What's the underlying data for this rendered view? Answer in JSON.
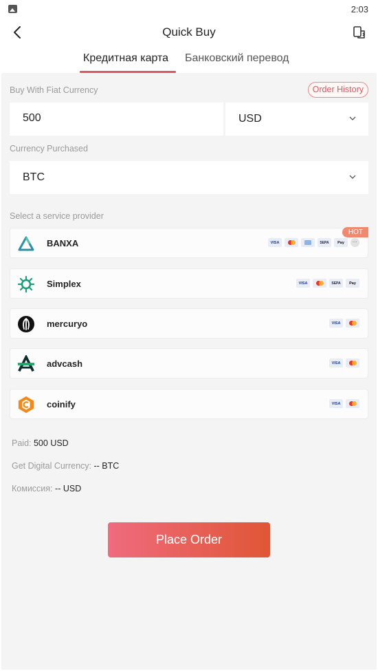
{
  "status_bar": {
    "time": "2:03"
  },
  "header": {
    "title": "Quick Buy"
  },
  "tabs": [
    {
      "label": "Кредитная карта",
      "active": true
    },
    {
      "label": "Банковский перевод",
      "active": false
    }
  ],
  "fiat": {
    "label": "Buy With Fiat Currency",
    "order_history": "Order History",
    "amount": "500",
    "currency": "USD"
  },
  "crypto": {
    "label": "Currency Purchased",
    "currency": "BTC"
  },
  "providers_label": "Select a service provider",
  "providers": [
    {
      "name": "BANXA",
      "badge": "HOT",
      "methods": [
        "VISA",
        "MC",
        "CARD",
        "SEPA",
        "Pay",
        "···"
      ]
    },
    {
      "name": "Simplex",
      "methods": [
        "VISA",
        "MC",
        "SEPA",
        "Pay"
      ]
    },
    {
      "name": "mercuryo",
      "methods": [
        "VISA",
        "MC"
      ]
    },
    {
      "name": "advcash",
      "methods": [
        "VISA",
        "MC"
      ]
    },
    {
      "name": "coinify",
      "methods": [
        "VISA",
        "MC"
      ]
    }
  ],
  "summary": {
    "paid_label": "Paid:",
    "paid_value": "500 USD",
    "get_label": "Get Digital Currency:",
    "get_value": "-- BTC",
    "fee_label": "Комиссия:",
    "fee_value": "-- USD"
  },
  "place_order": "Place Order",
  "colors": {
    "accent": "#e2535f",
    "button_start": "#ef6b7e",
    "button_end": "#e05635"
  }
}
